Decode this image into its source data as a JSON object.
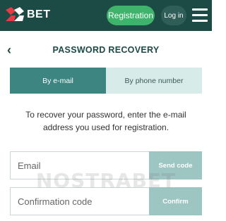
{
  "header": {
    "logo_text": "BET",
    "registration_label": "Registration",
    "login_label": "Log in"
  },
  "page": {
    "title": "PASSWORD RECOVERY"
  },
  "tabs": [
    {
      "label": "By e-mail",
      "active": true
    },
    {
      "label": "By phone number",
      "active": false
    }
  ],
  "instructions": "To recover your password, enter the e-mail address you used for registration.",
  "email": {
    "placeholder": "Email",
    "button_label": "Send code"
  },
  "confirmation": {
    "placeholder": "Confirmation code",
    "button_label": "Confirm"
  },
  "watermark": "NOSTRABET",
  "colors": {
    "header_bg": "#1c4a44",
    "registration_bg": "#3fb36b",
    "tab_active_bg": "#3d8580",
    "tab_inactive_bg": "#d7ebe9",
    "button_bg": "#9dc5c2"
  }
}
